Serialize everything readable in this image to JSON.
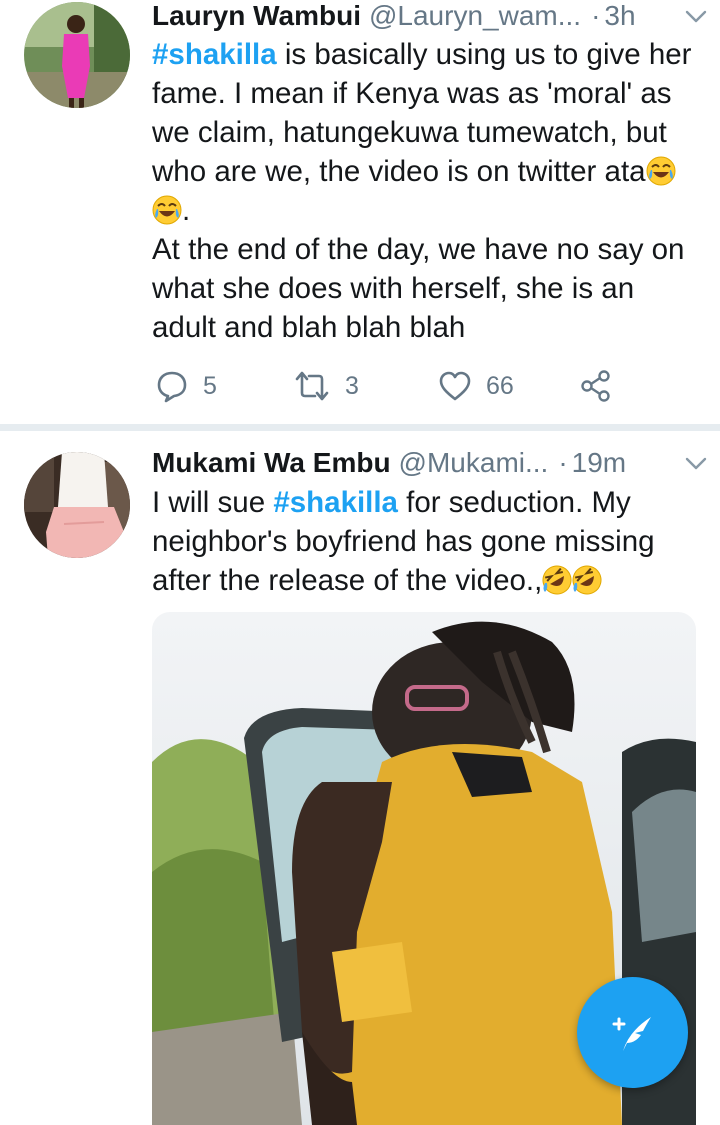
{
  "tweets": [
    {
      "name": "Lauryn Wambui",
      "handle": "@Lauryn_wam...",
      "dot": "·",
      "time": "3h",
      "hashtag": "#shakilla",
      "text_after_hashtag": " is basically using us to give her fame.  I mean if Kenya was as 'moral' as we claim,  hatungekuwa tumewatch, but who are we,  the video is on twitter ata",
      "text_after_emojis": ".",
      "paragraph2": "At the end of the day,  we have no say on what she does with herself, she is an adult and blah blah blah",
      "emojis": [
        "face-with-tears-of-joy",
        "face-with-tears-of-joy"
      ],
      "reply_count": "5",
      "retweet_count": "3",
      "like_count": "66"
    },
    {
      "name": "Mukami Wa Embu",
      "handle": "@Mukami...",
      "dot": "·",
      "time": "19m",
      "text_before_hashtag": "I will sue ",
      "hashtag": "#shakilla",
      "text_after_hashtag": " for seduction. My neighbor's boyfriend has gone missing after the release of the video.,",
      "emojis": [
        "rolling-on-the-floor-laughing",
        "rolling-on-the-floor-laughing"
      ]
    }
  ],
  "icons": {
    "reply": "reply-icon",
    "retweet": "retweet-icon",
    "like": "heart-icon",
    "share": "share-icon",
    "caret": "chevron-down-icon",
    "compose": "compose-tweet-icon"
  },
  "colors": {
    "link": "#1da1f2",
    "secondary_text": "#657786",
    "fab": "#1da1f2",
    "divider": "#e6ecf0"
  }
}
